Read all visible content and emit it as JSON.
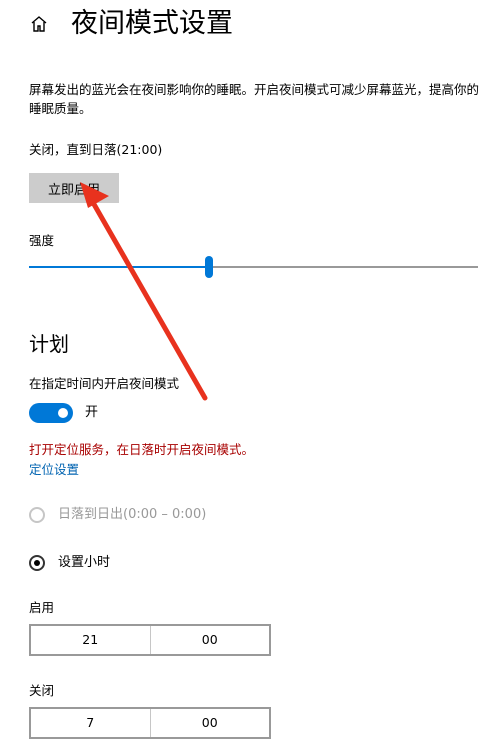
{
  "header": {
    "home_icon": "home-icon",
    "title": "夜间模式设置"
  },
  "description": "屏幕发出的蓝光会在夜间影响你的睡眠。开启夜间模式可减少屏幕蓝光，提高你的睡眠质量。",
  "status": "关闭，直到日落(21:00)",
  "enable_button": "立即启用",
  "strength": {
    "label": "强度",
    "value_fraction": 0.4
  },
  "schedule": {
    "section_title": "计划",
    "toggle_label": "在指定时间内开启夜间模式",
    "toggle_state": "开",
    "toggle_on": true,
    "warning": "打开定位服务，在日落时开启夜间模式。",
    "location_link": "定位设置",
    "options": [
      {
        "label": "日落到日出(0:00 – 0:00)",
        "selected": false,
        "disabled": true
      },
      {
        "label": "设置小时",
        "selected": true,
        "disabled": false
      }
    ],
    "on_time": {
      "label": "启用",
      "hour": "21",
      "minute": "00"
    },
    "off_time": {
      "label": "关闭",
      "hour": "7",
      "minute": "00"
    }
  },
  "colors": {
    "accent": "#0078d7",
    "warning": "#a80000",
    "link": "#0063b1",
    "annotation_arrow": "#e8321e"
  }
}
